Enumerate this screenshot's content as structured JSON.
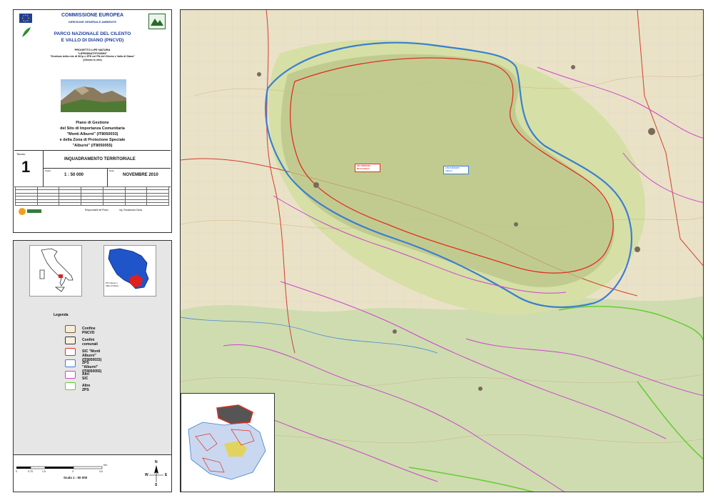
{
  "header": {
    "commission": "COMMISSIONE EUROPEA",
    "directorate": "DIREZIONE GENERALE AMBIENTE",
    "park_line1": "PARCO NAZIONALE DEL CILENTO",
    "park_line2": "E VALLO DI DIANO (PNCVD)",
    "project_line1": "PROGETTO LIFE NATURA",
    "project_line2": "\"LIFE08NAT/IT/00053\"",
    "project_line3": "\"Gestione della rete di SICp e ZPS nel PN del Cilento e Vallo di Diano\"",
    "project_line4": "(Cilento in rete)"
  },
  "plan": {
    "line1": "Piano di Gestione",
    "line2": "del Sito di Importanza Comunitaria",
    "line3": "\"Monti Alburni\" (IT8050033)",
    "line4": "e della Zona di Protezione Speciale",
    "line5": "\"Alburni\" (IT8050055)"
  },
  "sheet": {
    "tavola_label": "Tavola:",
    "number": "1",
    "title": "INQUADRAMENTO TERRITORIALE",
    "scale_label": "Scala:",
    "scale": "1 : 50 000",
    "date_label": "Data:",
    "date": "NOVEMBRE 2010",
    "responsible": "Responsabili del Piano:",
    "responsible_name": "Ing. Rosalandra Garza"
  },
  "legend": {
    "title": "Legenda",
    "items": [
      {
        "label": "Confine PNCVD",
        "color": "#7a5c2e",
        "fill": "#f3edd8"
      },
      {
        "label": "Confini comunali",
        "color": "#333333",
        "fill": "#f5f0e0"
      },
      {
        "label": "SIC \"Monti Alburni\" (IT8050033)",
        "color": "#e03020",
        "fill": "#ffffff"
      },
      {
        "label": "ZPS \"Alburni\" (IT8050055)",
        "color": "#3a7fd0",
        "fill": "#ffffff"
      },
      {
        "label": "Altri SIC",
        "color": "#cc44cc",
        "fill": "#ffffff"
      },
      {
        "label": "Altre ZPS",
        "color": "#66cc33",
        "fill": "#ffffff"
      }
    ]
  },
  "inset": {
    "pn_label_line1": "PN Cilento e",
    "pn_label_line2": "Vallo di Diano"
  },
  "scalebar": {
    "unit": "Km",
    "ticks": [
      "0",
      "0.75",
      "1.5",
      "3",
      "4.5"
    ],
    "scale_text": "Scala 1 : 50 000",
    "north": "N",
    "west": "W",
    "east": "E",
    "south": "S"
  },
  "map_labels": {
    "sic_box_line1": "SIC IT8050033",
    "sic_box_line2": "Monti Alburni",
    "zps_box_line1": "ZPS IT8050055",
    "zps_box_line2": "Alburni"
  },
  "colors": {
    "sic": "#e03020",
    "zps": "#3a7fd0",
    "other_sic": "#cc44cc",
    "other_zps": "#66cc33",
    "park_fill": "#c9d8a0"
  }
}
